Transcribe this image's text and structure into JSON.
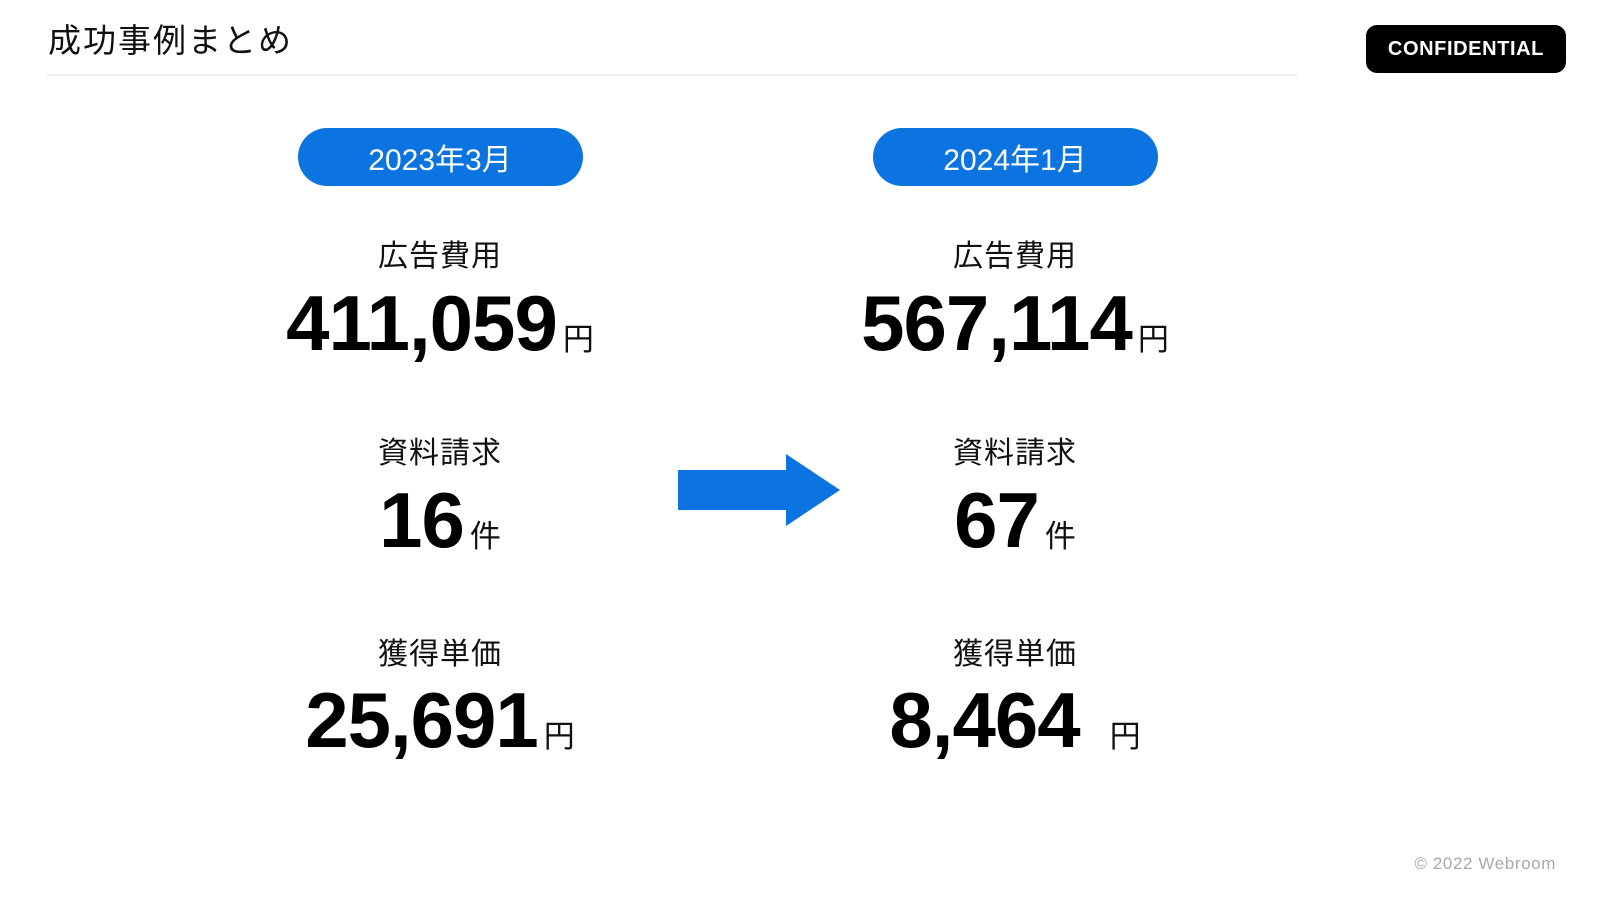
{
  "header": {
    "title": "成功事例まとめ",
    "badge_label": "CONFIDENTIAL"
  },
  "theme": {
    "accent_blue": "#0b74e0",
    "badge_bg": "#000000",
    "badge_text": "#ffffff",
    "rule_color": "#ececec",
    "footer_text_color": "#a9a9a9"
  },
  "comparison": {
    "arrow_icon": "arrow-right-icon",
    "before": {
      "period_label": "2023年3月",
      "metrics": [
        {
          "label": "広告費用",
          "value": "411,059",
          "unit": "円"
        },
        {
          "label": "資料請求",
          "value": "16",
          "unit": "件"
        },
        {
          "label": "獲得単価",
          "value": "25,691",
          "unit": "円"
        }
      ]
    },
    "after": {
      "period_label": "2024年1月",
      "metrics": [
        {
          "label": "広告費用",
          "value": "567,114",
          "unit": "円"
        },
        {
          "label": "資料請求",
          "value": "67",
          "unit": "件"
        },
        {
          "label": "獲得単価",
          "value": "8,464",
          "unit": "円"
        }
      ]
    }
  },
  "footer": {
    "copyright": "© 2022 Webroom"
  }
}
